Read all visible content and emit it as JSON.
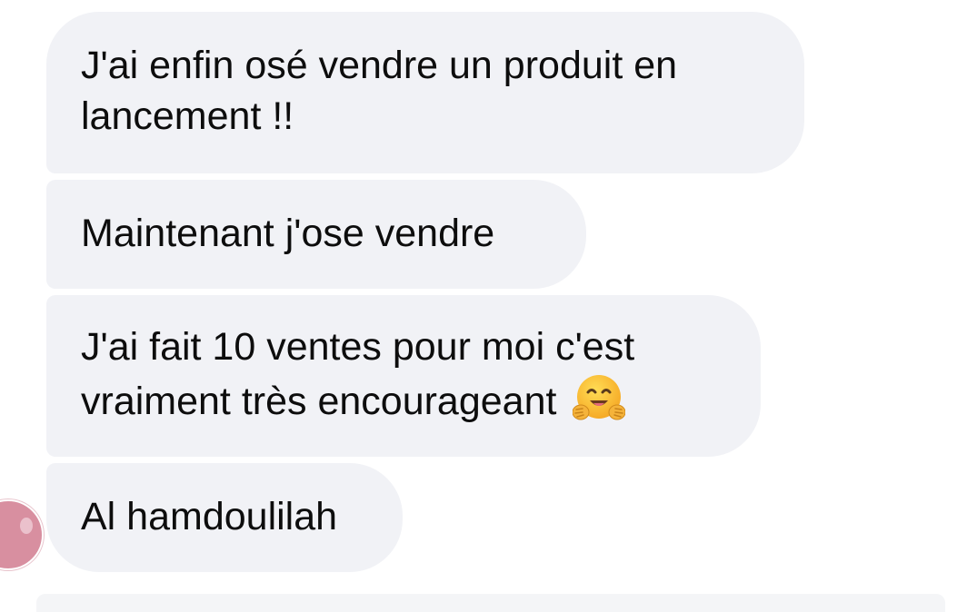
{
  "messages": [
    {
      "lines": [
        "J'ai enfin osé vendre un produit en",
        "lancement !!"
      ]
    },
    {
      "lines": [
        "Maintenant j'ose vendre"
      ]
    },
    {
      "lines": [
        "J'ai fait 10 ventes pour moi c'est",
        "vraiment très encourageant"
      ],
      "emoji": "hugging-face-icon"
    },
    {
      "lines": [
        "Al hamdoulilah"
      ]
    }
  ],
  "colors": {
    "bubble_background": "#f1f2f6",
    "text": "#0d0d0d",
    "avatar": "#d88fa0",
    "emoji_yellow": "#f9c23c"
  }
}
